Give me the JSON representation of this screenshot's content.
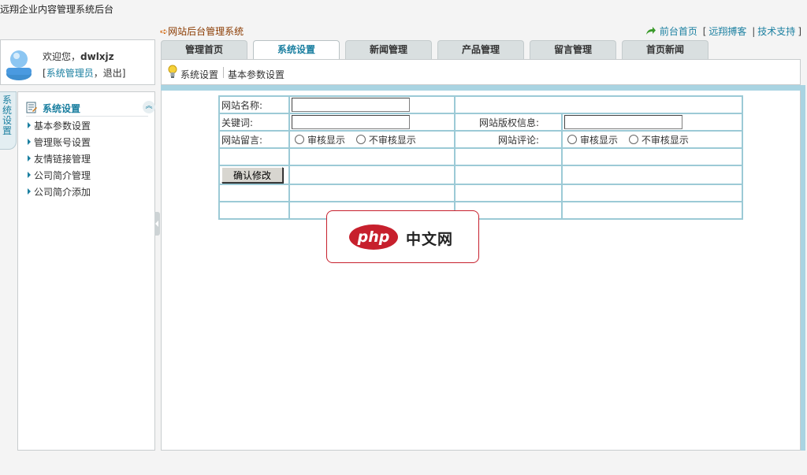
{
  "header": {
    "app_title": "远翔企业内容管理系统后台",
    "sub_title": "网站后台管理系统",
    "links": [
      {
        "label": "前台首页"
      },
      {
        "label": "远翔搏客"
      },
      {
        "label": "技术支持"
      }
    ]
  },
  "user": {
    "welcome_prefix": "欢迎您，",
    "username": "dwlxjz",
    "role": "系统管理员",
    "logout": "退出"
  },
  "tabs": [
    {
      "label": "管理首页",
      "active": false
    },
    {
      "label": "系统设置",
      "active": true
    },
    {
      "label": "新闻管理",
      "active": false
    },
    {
      "label": "产品管理",
      "active": false
    },
    {
      "label": "留言管理",
      "active": false
    },
    {
      "label": "首页新闻",
      "active": false
    }
  ],
  "breadcrumb": {
    "section": "系统设置",
    "page": "基本参数设置"
  },
  "sidebar": {
    "vertical_tab": "系统设置",
    "menu_title": "系统设置",
    "items": [
      {
        "label": "基本参数设置"
      },
      {
        "label": "管理账号设置"
      },
      {
        "label": "友情链接管理"
      },
      {
        "label": "公司简介管理"
      },
      {
        "label": "公司简介添加"
      }
    ]
  },
  "form": {
    "site_name_label": "网站名称:",
    "site_name_value": "",
    "keywords_label": "关键词:",
    "keywords_value": "",
    "copyright_label": "网站版权信息:",
    "copyright_value": "",
    "guestbook_label": "网站留言:",
    "comment_label": "网站评论:",
    "option_audit": "审核显示",
    "option_no_audit": "不审核显示",
    "submit_label": "确认修改"
  },
  "watermark": {
    "logo_text": "php",
    "site_text": "中文网"
  },
  "colors": {
    "accent": "#1a7fa0",
    "stripe": "#a9d4e2",
    "watermark_red": "#c7202d"
  }
}
